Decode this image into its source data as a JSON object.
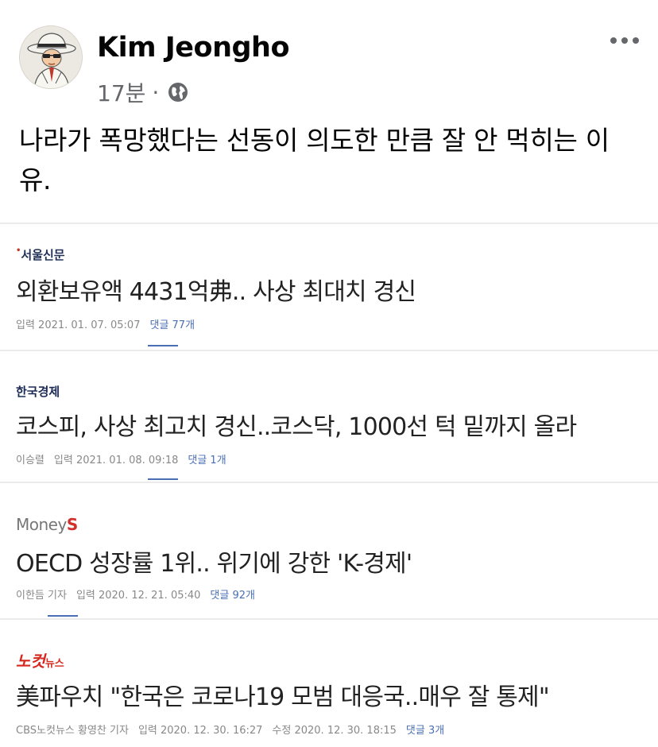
{
  "post": {
    "author": "Kim Jeongho",
    "time": "17분",
    "separator": "·",
    "privacy_icon": "globe-icon",
    "menu_icon": "more-options-icon",
    "text": "나라가 폭망했다는 선동이 의도한 만큼 잘 안 먹히는 이유."
  },
  "articles": [
    {
      "source": "서울신문",
      "headline": "외환보유액 4431억弗.. 사상 최대치 경신",
      "reporter": "",
      "date": "입력 2021. 01. 07. 05:07",
      "comments": "댓글 77개"
    },
    {
      "source": "한국경제",
      "headline": "코스피, 사상 최고치 경신..코스닥, 1000선 턱 밑까지 올라",
      "reporter": "이승렬",
      "date": "입력 2021. 01. 08. 09:18",
      "comments": "댓글 1개"
    },
    {
      "source_main": "Money",
      "source_accent": "S",
      "headline": "OECD 성장률 1위.. 위기에 강한 'K-경제'",
      "reporter": "이한듬 기자",
      "date": "입력 2020. 12. 21. 05:40",
      "comments": "댓글 92개"
    },
    {
      "source_main": "노컷",
      "source_sub": "뉴스",
      "headline": "美파우치 \"한국은 코로나19 모범 대응국..매우 잘 통제\"",
      "reporter": "CBS노컷뉴스 황영찬 기자",
      "date": "입력 2020. 12. 30. 16:27",
      "modified": "수정 2020. 12. 30. 18:15",
      "comments": "댓글 3개"
    }
  ],
  "colors": {
    "accent": "#4a6fb5",
    "meta_text": "#65676b",
    "divider": "#ebebeb"
  }
}
